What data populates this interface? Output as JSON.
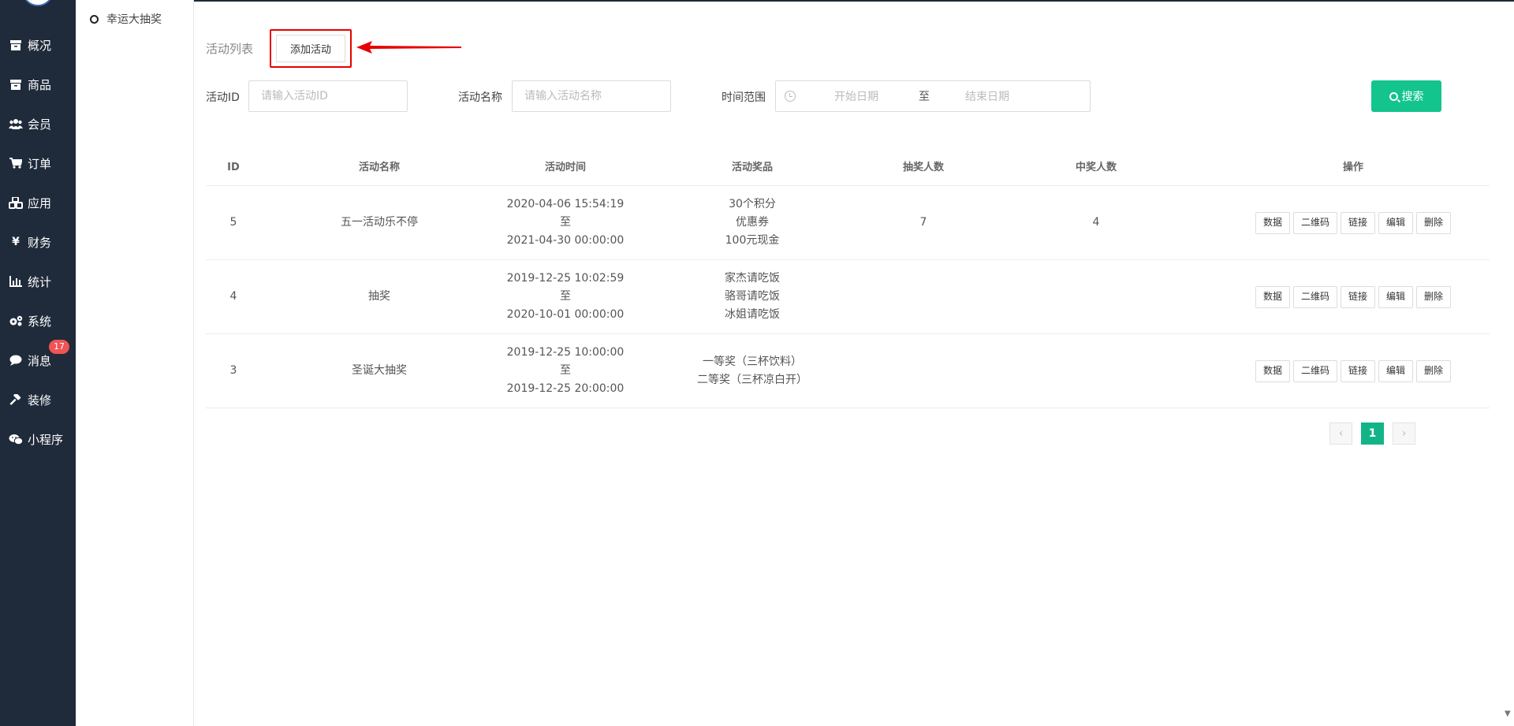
{
  "nav": {
    "items": [
      {
        "label": "概况",
        "icon": "archive-icon"
      },
      {
        "label": "商品",
        "icon": "archive-icon"
      },
      {
        "label": "会员",
        "icon": "users-icon"
      },
      {
        "label": "订单",
        "icon": "cart-icon"
      },
      {
        "label": "应用",
        "icon": "cubes-icon"
      },
      {
        "label": "财务",
        "icon": "yen-icon"
      },
      {
        "label": "统计",
        "icon": "bar-chart-icon"
      },
      {
        "label": "系统",
        "icon": "gears-icon"
      },
      {
        "label": "消息",
        "icon": "comment-icon"
      },
      {
        "label": "装修",
        "icon": "gavel-icon"
      },
      {
        "label": "小程序",
        "icon": "wechat-icon"
      }
    ],
    "message_badge": "17"
  },
  "subnav": {
    "item": "幸运大抽奖"
  },
  "page": {
    "title": "活动列表",
    "add_button": "添加活动"
  },
  "filters": {
    "id_label": "活动ID",
    "id_placeholder": "请输入活动ID",
    "name_label": "活动名称",
    "name_placeholder": "请输入活动名称",
    "range_label": "时间范围",
    "start_placeholder": "开始日期",
    "range_sep": "至",
    "end_placeholder": "结束日期",
    "search_button": "搜索"
  },
  "table": {
    "headers": [
      "ID",
      "活动名称",
      "活动时间",
      "活动奖品",
      "抽奖人数",
      "中奖人数",
      "操作"
    ],
    "rows": [
      {
        "id": "5",
        "name": "五一活动乐不停",
        "start": "2020-04-06 15:54:19",
        "sep": "至",
        "end": "2021-04-30 00:00:00",
        "prizes": [
          "30个积分",
          "优惠券",
          "100元现金"
        ],
        "draw_count": "7",
        "win_count": "4"
      },
      {
        "id": "4",
        "name": "抽奖",
        "start": "2019-12-25 10:02:59",
        "sep": "至",
        "end": "2020-10-01 00:00:00",
        "prizes": [
          "家杰请吃饭",
          "骆哥请吃饭",
          "冰姐请吃饭"
        ],
        "draw_count": "",
        "win_count": ""
      },
      {
        "id": "3",
        "name": "圣诞大抽奖",
        "start": "2019-12-25 10:00:00",
        "sep": "至",
        "end": "2019-12-25 20:00:00",
        "prizes": [
          "一等奖（三杯饮料）",
          "二等奖（三杯凉白开）"
        ],
        "draw_count": "",
        "win_count": ""
      }
    ],
    "actions": [
      "数据",
      "二维码",
      "链接",
      "编辑",
      "删除"
    ]
  },
  "pagination": {
    "current": "1",
    "prev": "‹",
    "next": "›"
  },
  "colors": {
    "sidebar": "#1f2a3a",
    "accent": "#13c48c",
    "highlight": "#e60000",
    "badge": "#f05454"
  }
}
